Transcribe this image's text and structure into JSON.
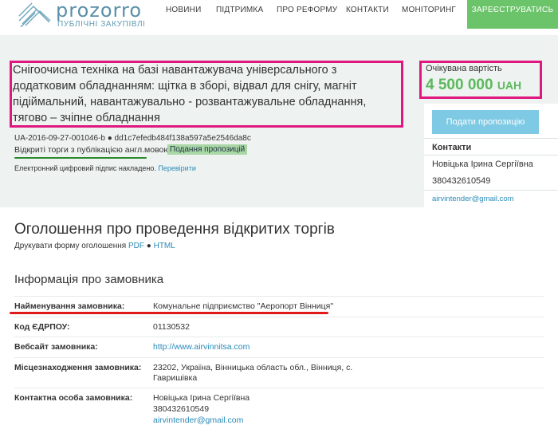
{
  "header": {
    "logo_text": "prozorro",
    "logo_sub": "ПУБЛІЧНІ ЗАКУПІВЛІ",
    "nav": [
      "НОВИНИ",
      "ПІДТРИМКА",
      "ПРО РЕФОРМУ",
      "КОНТАКТИ",
      "МОНІТОРИНГ"
    ],
    "register": "ЗАРЕЄСТРУВАТИСЬ"
  },
  "tender": {
    "title": "Снігоочисна техніка на базі навантажувача універсального з додатковим обладнанням: щітка в зборі, відвал для снігу, магніт підіймальний, навантажувально - розвантажувальне обладнання, тягово – зчіпне обладнання",
    "id": "UA-2016-09-27-001046-b ● dd1c7efedb484f138a597a5e2546da8c",
    "procedure_type": "Відкриті торги з публікацією англ.мовою",
    "status": "Подання пропозицій",
    "esign_text": "Електронний цифровий підпис накладено.",
    "esign_link": "Перевірити"
  },
  "price": {
    "label": "Очікувана вартість",
    "amount": "4 500 000",
    "currency": "UAH"
  },
  "sidebar": {
    "submit": "Подати пропозицію",
    "contacts_title": "Контакти",
    "name": "Новіцька Ірина Сергіївна",
    "phone": "380432610549",
    "email": "airvintender@gmail.com"
  },
  "announcement": {
    "title": "Оголошення про проведення відкритих торгів",
    "print_text": "Друкувати форму оголошення",
    "pdf": "PDF",
    "sep": "●",
    "html": "HTML"
  },
  "customer": {
    "section_title": "Інформація про замовника",
    "rows": [
      {
        "label": "Найменування замовника:",
        "value": "Комунальне підприємство \"Аеропорт Вінниця\""
      },
      {
        "label": "Код ЄДРПОУ:",
        "value": "01130532"
      },
      {
        "label": "Вебсайт замовника:",
        "value": "http://www.airvinnitsa.com"
      },
      {
        "label": "Місцезнаходження замовника:",
        "value_lines": [
          "23202, Україна, Вінницька область обл., Вінниця, с.",
          "Гавришівка"
        ]
      },
      {
        "label": "Контактна особа замовника:",
        "value_lines": [
          "Новіцька Ірина Сергіївна",
          "380432610549",
          "airvintender@gmail.com"
        ]
      }
    ]
  },
  "colors": {
    "accent_green": "#5cb85c",
    "link_blue": "#2a8ab7",
    "highlight_pink": "#e0177e",
    "highlight_red": "#e01a1a"
  }
}
